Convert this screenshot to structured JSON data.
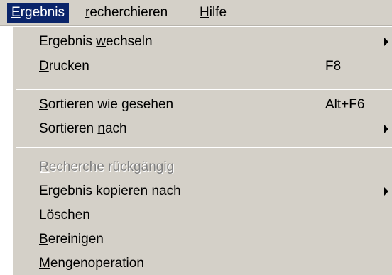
{
  "menubar": {
    "items": [
      {
        "pre": "",
        "ul": "E",
        "post": "rgebnis"
      },
      {
        "pre": "",
        "ul": "r",
        "post": "echerchieren"
      },
      {
        "pre": "",
        "ul": "H",
        "post": "ilfe"
      }
    ]
  },
  "dropdown": {
    "items": [
      {
        "pre": "Ergebnis ",
        "ul": "w",
        "post": "echseln",
        "shortcut": "",
        "submenu": true,
        "enabled": true
      },
      {
        "pre": "",
        "ul": "D",
        "post": "rucken",
        "shortcut": "F8",
        "submenu": false,
        "enabled": true
      },
      {
        "pre": "",
        "ul": "S",
        "post": "ortieren wie gesehen",
        "shortcut": "Alt+F6",
        "submenu": false,
        "enabled": true
      },
      {
        "pre": "Sortieren ",
        "ul": "n",
        "post": "ach",
        "shortcut": "",
        "submenu": true,
        "enabled": true
      },
      {
        "pre": "",
        "ul": "R",
        "post": "echerche rückgängig",
        "shortcut": "",
        "submenu": false,
        "enabled": false
      },
      {
        "pre": "Ergebnis ",
        "ul": "k",
        "post": "opieren nach",
        "shortcut": "",
        "submenu": true,
        "enabled": true
      },
      {
        "pre": "",
        "ul": "L",
        "post": "öschen",
        "shortcut": "",
        "submenu": false,
        "enabled": true
      },
      {
        "pre": "",
        "ul": "B",
        "post": "ereinigen",
        "shortcut": "",
        "submenu": false,
        "enabled": true
      },
      {
        "pre": "",
        "ul": "M",
        "post": "engenoperation",
        "shortcut": "",
        "submenu": false,
        "enabled": true
      }
    ]
  }
}
